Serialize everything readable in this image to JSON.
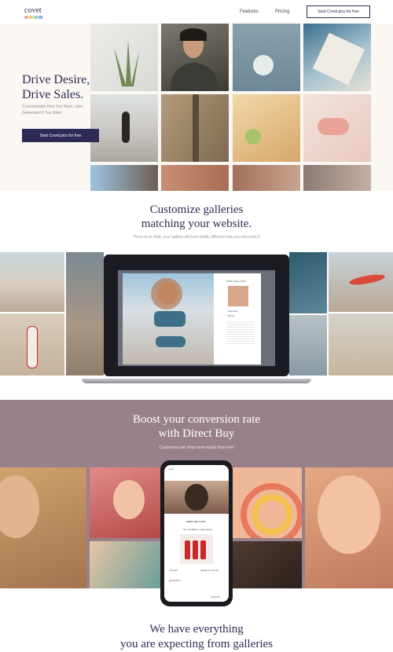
{
  "nav": {
    "logo_text": "covet",
    "logo_colors": [
      "#f7a8b8",
      "#f9c96a",
      "#8fd3c7",
      "#7fb2f0"
    ],
    "features": "Features",
    "pricing": "Pricing",
    "cta": "Start Covet.pics for free"
  },
  "hero": {
    "title_line1": "Drive Desire,",
    "title_line2": "Drive Sales.",
    "subtitle": "Customizable How You Want. User Generated If You Want",
    "button": "Start Covet.pics for free"
  },
  "customize": {
    "title_line1": "Customize galleries",
    "title_line2": "matching your website.",
    "subtitle": "There is no limit, your gallery will look totally different how you decorate it"
  },
  "laptop_screen": {
    "shop_label": "SHOP THE LOOK",
    "product_name": "Swimsuit",
    "price": "$5.00"
  },
  "conversion": {
    "title_line1": "Boost your conversion rate",
    "title_line2": "with Direct Buy",
    "subtitle": "Customers can shop more easily than ever"
  },
  "phone_screen": {
    "time": "2:16",
    "shop_label": "SHOP THE LOOK",
    "product_name": "Nyx Cardigan Longer Name",
    "color_label": "COLOR",
    "select_color": "SELECT COLOR",
    "quantity_label": "QUANTITY",
    "price": "$120.00"
  },
  "everything": {
    "title_line1": "We have everything",
    "title_line2": "you are expecting from galleries"
  },
  "colors": {
    "brand": "#2d2b55",
    "hero_bg": "#fbf8f4",
    "mauve": "#98818a"
  }
}
